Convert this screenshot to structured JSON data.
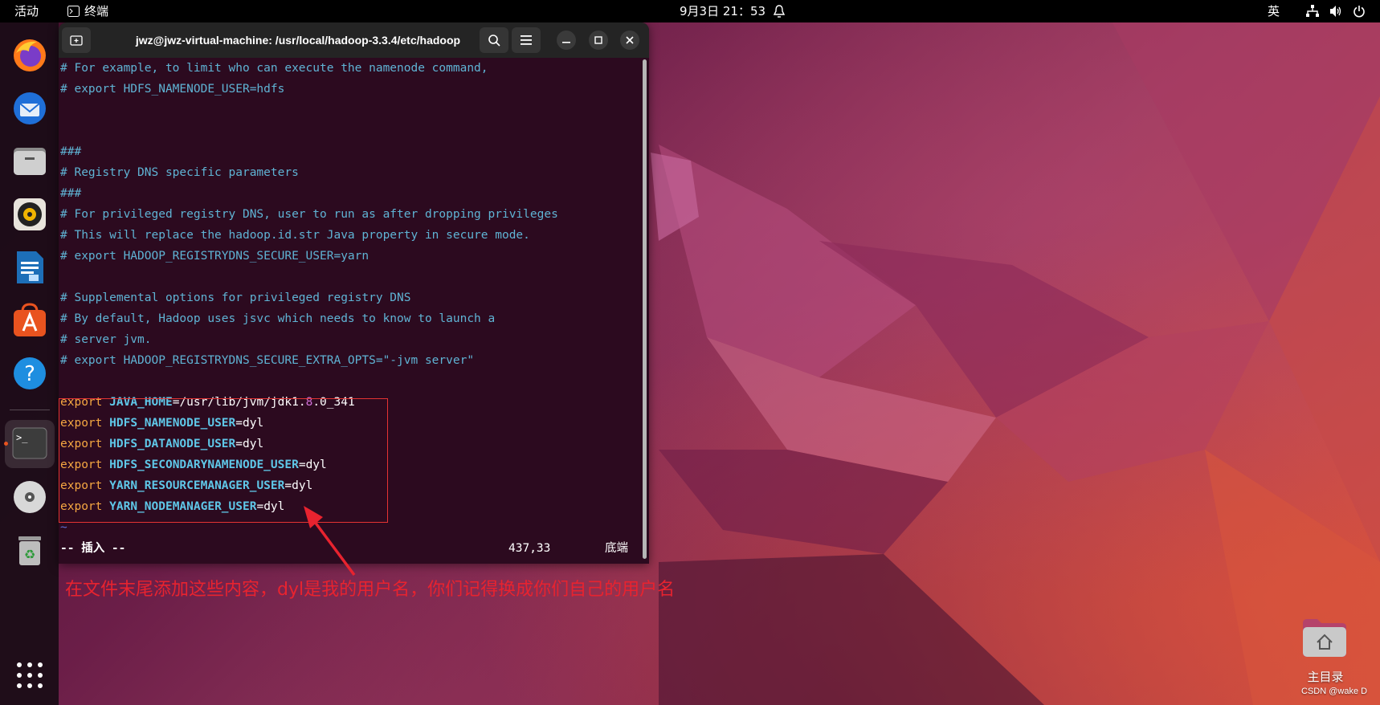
{
  "topbar": {
    "activities": "活动",
    "app_name": "终端",
    "clock": "9月3日  21：53",
    "input_method": "英"
  },
  "terminal": {
    "title": "jwz@jwz-virtual-machine: /usr/local/hadoop-3.3.4/etc/hadoop",
    "lines": [
      "# For example, to limit who can execute the namenode command,",
      "# export HDFS_NAMENODE_USER=hdfs",
      "",
      "",
      "###",
      "# Registry DNS specific parameters",
      "###",
      "# For privileged registry DNS, user to run as after dropping privileges",
      "# This will replace the hadoop.id.str Java property in secure mode.",
      "# export HADOOP_REGISTRYDNS_SECURE_USER=yarn",
      "",
      "# Supplemental options for privileged registry DNS",
      "# By default, Hadoop uses jsvc which needs to know to launch a",
      "# server jvm.",
      "# export HADOOP_REGISTRYDNS_SECURE_EXTRA_OPTS=\"-jvm server\"",
      ""
    ],
    "exports": [
      {
        "keyword": "export",
        "name": "JAVA_HOME",
        "eq": "=",
        "value_a": "/usr/lib/jvm/jdk1.",
        "value_num": "8",
        "value_b": ".0_341"
      },
      {
        "keyword": "export",
        "name": "HDFS_NAMENODE_USER",
        "eq": "=",
        "value": "dyl"
      },
      {
        "keyword": "export",
        "name": "HDFS_DATANODE_USER",
        "eq": "=",
        "value": "dyl"
      },
      {
        "keyword": "export",
        "name": "HDFS_SECONDARYNAMENODE_USER",
        "eq": "=",
        "value": "dyl"
      },
      {
        "keyword": "export",
        "name": "YARN_RESOURCEMANAGER_USER",
        "eq": "=",
        "value": "dyl"
      },
      {
        "keyword": "export",
        "name": "YARN_NODEMANAGER_USER",
        "eq": "=",
        "value": "dyl"
      }
    ],
    "tilde": "~",
    "mode": "-- 插入 --",
    "cursor_pos": "437,33",
    "scroll_pos": "底端"
  },
  "annotation": "在文件末尾添加这些内容，dyl是我的用户名，你们记得换成你们自己的用户名",
  "desktop": {
    "home_label": "主目录",
    "watermark": "CSDN @wake D"
  },
  "dock_apps": [
    "firefox-icon",
    "thunderbird-icon",
    "files-icon",
    "rhythmbox-icon",
    "writer-icon",
    "app-center-icon",
    "help-icon",
    "terminal-icon",
    "dvd-icon",
    "trash-icon",
    "show-apps-icon"
  ],
  "colors": {
    "terminal_bg": "#2c0a1f",
    "comment": "#5fb3d4",
    "keyword": "#f5a742",
    "variable": "#5fc7e8",
    "annotation": "#e8232f"
  }
}
